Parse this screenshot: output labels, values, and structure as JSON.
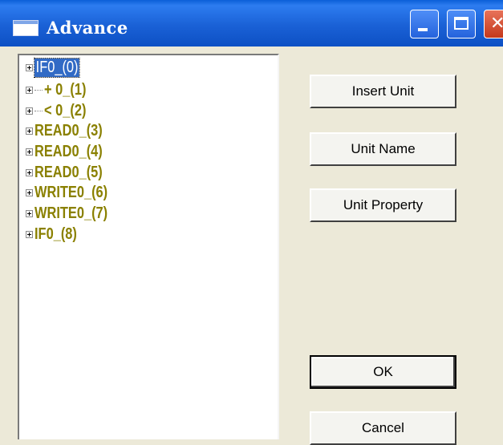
{
  "window": {
    "title": "Advance",
    "icon": "app-window-icon"
  },
  "titlebar_buttons": {
    "minimize_icon": "minimize-icon",
    "maximize_icon": "maximize-icon",
    "close_icon": "close-icon"
  },
  "tree": {
    "items": [
      {
        "label": "IF0_(0)",
        "selected": true
      },
      {
        "label": "+ 0_(1)",
        "selected": false
      },
      {
        "label": "< 0_(2)",
        "selected": false
      },
      {
        "label": "READ0_(3)",
        "selected": false
      },
      {
        "label": "READ0_(4)",
        "selected": false
      },
      {
        "label": "READ0_(5)",
        "selected": false
      },
      {
        "label": "WRITE0_(6)",
        "selected": false
      },
      {
        "label": "WRITE0_(7)",
        "selected": false
      },
      {
        "label": "IF0_(8)",
        "selected": false
      }
    ]
  },
  "buttons": {
    "insert_unit": "Insert Unit",
    "unit_name": "Unit Name",
    "unit_property": "Unit Property",
    "ok": "OK",
    "cancel": "Cancel"
  },
  "colors": {
    "titlebar": "#1a61d6",
    "tree_text": "#8a8000",
    "selection": "#316ac5",
    "dialog_bg": "#ece9d8"
  }
}
